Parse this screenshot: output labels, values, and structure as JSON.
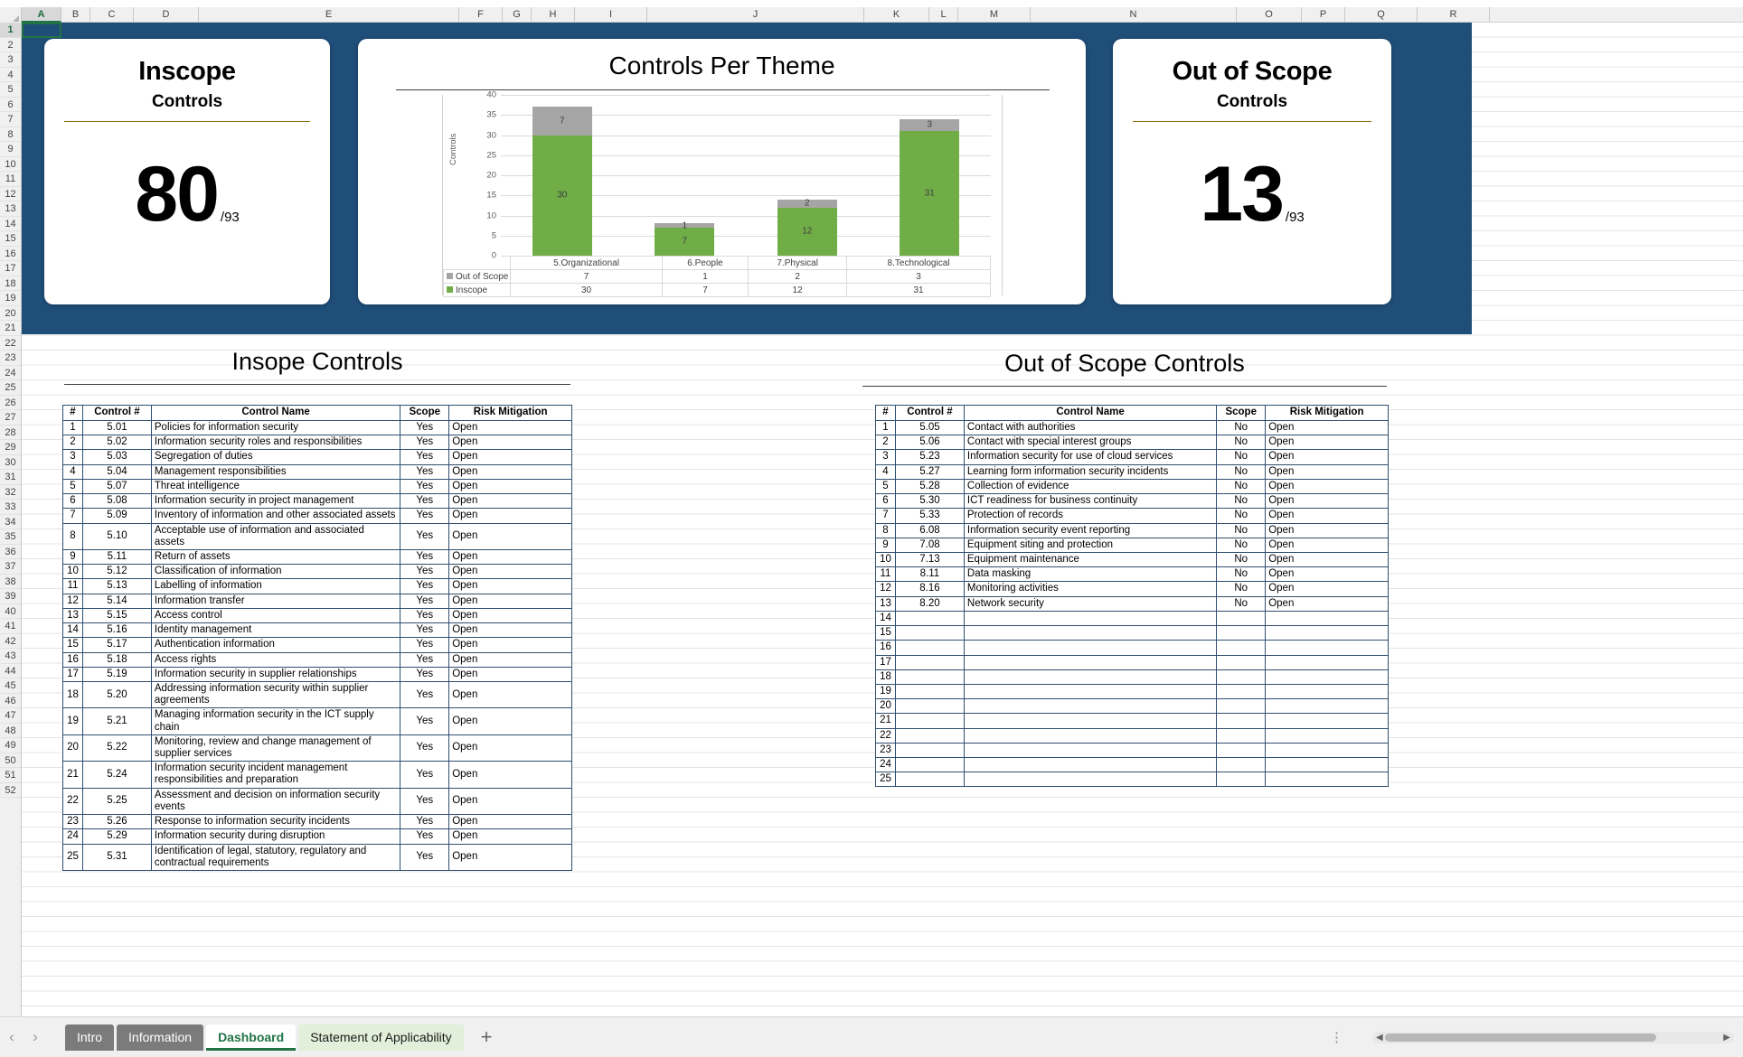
{
  "spreadsheet": {
    "columns": [
      "A",
      "B",
      "C",
      "D",
      "E",
      "F",
      "G",
      "H",
      "I",
      "J",
      "K",
      "L",
      "M",
      "N",
      "O",
      "P",
      "Q",
      "R"
    ],
    "selected_column": "A",
    "selected_row": "1",
    "row_count": 52
  },
  "kpi_inscope": {
    "title": "Inscope",
    "subtitle": "Controls",
    "value": "80",
    "denominator": "/93"
  },
  "kpi_outscope": {
    "title": "Out of Scope",
    "subtitle": "Controls",
    "value": "13",
    "denominator": "/93"
  },
  "chart_data": {
    "type": "bar",
    "title": "Controls Per Theme",
    "xlabel": "",
    "ylabel": "Controls",
    "ylim": [
      0,
      40
    ],
    "yticks": [
      0,
      5,
      10,
      15,
      20,
      25,
      30,
      35,
      40
    ],
    "grid": true,
    "stacked": true,
    "legend_position": "data-table",
    "categories": [
      "5.Organizational",
      "6.People",
      "7.Physical",
      "8.Technological"
    ],
    "series": [
      {
        "name": "Inscope",
        "values": [
          30,
          7,
          12,
          31
        ],
        "color": "#70ad47"
      },
      {
        "name": "Out of Scope",
        "values": [
          7,
          1,
          2,
          3
        ],
        "color": "#a5a5a5"
      }
    ],
    "data_table_order": [
      "Out of Scope",
      "Inscope"
    ]
  },
  "inscope_section": {
    "title": "Insope Controls",
    "headers": [
      "#",
      "Control #",
      "Control Name",
      "Scope",
      "Risk Mitigation"
    ],
    "rows": [
      [
        "1",
        "5.01",
        "Policies for information security",
        "Yes",
        "Open"
      ],
      [
        "2",
        "5.02",
        "Information security roles and responsibilities",
        "Yes",
        "Open"
      ],
      [
        "3",
        "5.03",
        "Segregation of duties",
        "Yes",
        "Open"
      ],
      [
        "4",
        "5.04",
        "Management responsibilities",
        "Yes",
        "Open"
      ],
      [
        "5",
        "5.07",
        "Threat intelligence",
        "Yes",
        "Open"
      ],
      [
        "6",
        "5.08",
        "Information security in project management",
        "Yes",
        "Open"
      ],
      [
        "7",
        "5.09",
        "Inventory of information and other associated assets",
        "Yes",
        "Open"
      ],
      [
        "8",
        "5.10",
        "Acceptable use of information and associated assets",
        "Yes",
        "Open"
      ],
      [
        "9",
        "5.11",
        "Return of assets",
        "Yes",
        "Open"
      ],
      [
        "10",
        "5.12",
        "Classification of information",
        "Yes",
        "Open"
      ],
      [
        "11",
        "5.13",
        "Labelling of information",
        "Yes",
        "Open"
      ],
      [
        "12",
        "5.14",
        "Information transfer",
        "Yes",
        "Open"
      ],
      [
        "13",
        "5.15",
        "Access control",
        "Yes",
        "Open"
      ],
      [
        "14",
        "5.16",
        "Identity management",
        "Yes",
        "Open"
      ],
      [
        "15",
        "5.17",
        "Authentication information",
        "Yes",
        "Open"
      ],
      [
        "16",
        "5.18",
        "Access rights",
        "Yes",
        "Open"
      ],
      [
        "17",
        "5.19",
        "Information security in supplier relationships",
        "Yes",
        "Open"
      ],
      [
        "18",
        "5.20",
        "Addressing information security within supplier agreements",
        "Yes",
        "Open"
      ],
      [
        "19",
        "5.21",
        "Managing information security in the ICT supply chain",
        "Yes",
        "Open"
      ],
      [
        "20",
        "5.22",
        "Monitoring, review and change management of supplier services",
        "Yes",
        "Open"
      ],
      [
        "21",
        "5.24",
        "Information security incident management responsibilities and preparation",
        "Yes",
        "Open"
      ],
      [
        "22",
        "5.25",
        "Assessment and decision on information security events",
        "Yes",
        "Open"
      ],
      [
        "23",
        "5.26",
        "Response to information security incidents",
        "Yes",
        "Open"
      ],
      [
        "24",
        "5.29",
        "Information security during disruption",
        "Yes",
        "Open"
      ],
      [
        "25",
        "5.31",
        "Identification of legal, statutory, regulatory and contractual requirements",
        "Yes",
        "Open"
      ]
    ]
  },
  "outscope_section": {
    "title": "Out of Scope Controls",
    "headers": [
      "#",
      "Control #",
      "Control Name",
      "Scope",
      "Risk Mitigation"
    ],
    "rows": [
      [
        "1",
        "5.05",
        "Contact with authorities",
        "No",
        "Open"
      ],
      [
        "2",
        "5.06",
        "Contact with special interest groups",
        "No",
        "Open"
      ],
      [
        "3",
        "5.23",
        "Information security for use of cloud services",
        "No",
        "Open"
      ],
      [
        "4",
        "5.27",
        "Learning form information security incidents",
        "No",
        "Open"
      ],
      [
        "5",
        "5.28",
        "Collection of evidence",
        "No",
        "Open"
      ],
      [
        "6",
        "5.30",
        "ICT readiness for business continuity",
        "No",
        "Open"
      ],
      [
        "7",
        "5.33",
        "Protection of records",
        "No",
        "Open"
      ],
      [
        "8",
        "6.08",
        "Information security event reporting",
        "No",
        "Open"
      ],
      [
        "9",
        "7.08",
        "Equipment siting and protection",
        "No",
        "Open"
      ],
      [
        "10",
        "7.13",
        "Equipment maintenance",
        "No",
        "Open"
      ],
      [
        "11",
        "8.11",
        "Data masking",
        "No",
        "Open"
      ],
      [
        "12",
        "8.16",
        "Monitoring activities",
        "No",
        "Open"
      ],
      [
        "13",
        "8.20",
        "Network security",
        "No",
        "Open"
      ],
      [
        "14",
        "",
        "",
        "",
        ""
      ],
      [
        "15",
        "",
        "",
        "",
        ""
      ],
      [
        "16",
        "",
        "",
        "",
        ""
      ],
      [
        "17",
        "",
        "",
        "",
        ""
      ],
      [
        "18",
        "",
        "",
        "",
        ""
      ],
      [
        "19",
        "",
        "",
        "",
        ""
      ],
      [
        "20",
        "",
        "",
        "",
        ""
      ],
      [
        "21",
        "",
        "",
        "",
        ""
      ],
      [
        "22",
        "",
        "",
        "",
        ""
      ],
      [
        "23",
        "",
        "",
        "",
        ""
      ],
      [
        "24",
        "",
        "",
        "",
        ""
      ],
      [
        "25",
        "",
        "",
        "",
        ""
      ]
    ]
  },
  "sheet_tabs": {
    "prev_label": "‹",
    "next_label": "›",
    "tabs": [
      {
        "label": "Intro",
        "state": "gray"
      },
      {
        "label": "Information",
        "state": "gray"
      },
      {
        "label": "Dashboard",
        "state": "active"
      },
      {
        "label": "Statement of Applicability",
        "state": "green"
      }
    ],
    "add_label": "+"
  },
  "colors": {
    "banner": "#1f4e79",
    "inscope_green": "#70ad47",
    "outscope_gray": "#a5a5a5",
    "accent_gold": "#8b6d14",
    "excel_green": "#217346"
  }
}
